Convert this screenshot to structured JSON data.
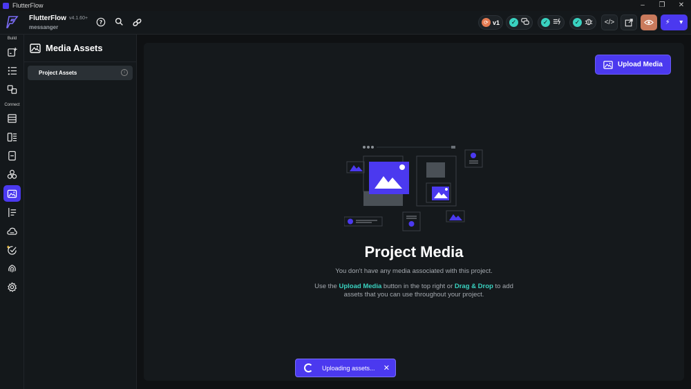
{
  "window": {
    "title": "FlutterFlow",
    "minimize": "–",
    "maximize": "❐",
    "close": "✕"
  },
  "project": {
    "name": "FlutterFlow",
    "version": "v4.1.60+",
    "subtitle": "messanger"
  },
  "topbar": {
    "version_pill": "v1",
    "icons": [
      "help-icon",
      "search-icon",
      "link-icon",
      "chat-icon",
      "flow-icon",
      "bug-icon",
      "code-icon",
      "open-external-icon",
      "eye-icon",
      "lightning-icon",
      "chevron-down-icon"
    ]
  },
  "rail": {
    "sections": [
      "Build",
      "Connect"
    ],
    "items": [
      "add-page-icon",
      "widget-tree-icon",
      "components-icon",
      "data-icon",
      "layout-icon",
      "file-icon",
      "integrations-icon",
      "media-icon",
      "api-icon",
      "cloud-icon",
      "agent-icon",
      "fingerprint-icon",
      "settings-icon"
    ]
  },
  "sidepanel": {
    "title": "Media Assets",
    "items": [
      {
        "label": "Project Assets",
        "info": "i"
      }
    ]
  },
  "main": {
    "upload_label": "Upload Media",
    "title": "Project Media",
    "subtitle": "You don't have any media associated with this project.",
    "help_pre": "Use the ",
    "help_upload": "Upload Media",
    "help_mid": " button in the top right or ",
    "help_drag": "Drag & Drop",
    "help_post": " to add assets that you can use throughout your project."
  },
  "toast": {
    "label": "Uploading assets...",
    "close": "✕"
  },
  "colors": {
    "accent": "#4b39ef",
    "success": "#39d2c0",
    "warning": "#e57b52",
    "background": "#0f1113"
  }
}
